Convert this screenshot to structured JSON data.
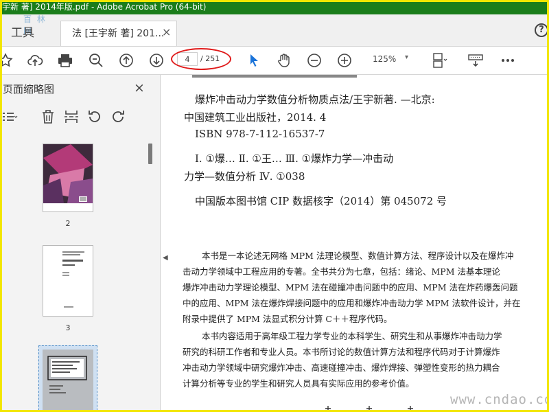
{
  "window": {
    "title": "宇新 著] 2014年版.pdf - Adobe Acrobat Pro (64-bit)"
  },
  "tabs": {
    "tools_label": "工具",
    "watermark": "百 林 网",
    "document_tab_label": "法 [王宇新 著] 201...",
    "close_glyph": "×",
    "help_glyph": "?"
  },
  "toolbar": {
    "current_page": "4",
    "total_pages": "/ 251",
    "zoom": "125%",
    "zoom_arrow": "▾"
  },
  "sidebar": {
    "title": "页面缩略图",
    "close_glyph": "×",
    "collapse_glyph": "◀",
    "thumbnails": [
      {
        "label": "2"
      },
      {
        "label": "3"
      },
      {
        "label": ""
      }
    ]
  },
  "document": {
    "lines": [
      "爆炸冲击动力学数值分析物质点法/王宇新著. —北京:",
      "中国建筑工业出版社，2014. 4",
      "ISBN 978-7-112-16537-7",
      "Ⅰ. ①爆…   Ⅱ. ①王…   Ⅲ. ①爆炸力学—冲击动",
      "力学—数值分析   Ⅳ. ①038",
      "中国版本图书馆 CIP 数据核字（2014）第 045072 号"
    ],
    "paragraph1": [
      "本书是一本论述无网格 MPM 法理论模型、数值计算方法、程序设计以及在爆炸冲",
      "击动力学领域中工程应用的专著。全书共分为七章，包括：绪论、MPM 法基本理论",
      "爆炸冲击动力学理论模型、MPM 法在碰撞冲击问题中的应用、MPM 法在炸药爆轰问题",
      "中的应用、MPM 法在爆炸焊接问题中的应用和爆炸冲击动力学 MPM 法软件设计，并在",
      "附录中提供了 MPM 法显式积分计算 C＋＋程序代码。"
    ],
    "paragraph2": [
      "本书内容适用于高年级工程力学专业的本科学生、研究生和从事爆炸冲击动力学",
      "研究的科研工作者和专业人员。本书所讨论的数值计算方法和程序代码对于计算爆炸",
      "冲击动力学领域中研究爆炸冲击、高速碰撞冲击、爆炸焊接、弹塑性变形的热力耦合",
      "计算分析等专业的学生和研究人员具有实际应用的参考价值。"
    ],
    "watermark": "www.cndao.com"
  },
  "colors": {
    "titlebar": "#1b7d1b",
    "frame": "#f2e600",
    "annotation": "#e01b1b",
    "select_tool": "#1a73d9"
  }
}
